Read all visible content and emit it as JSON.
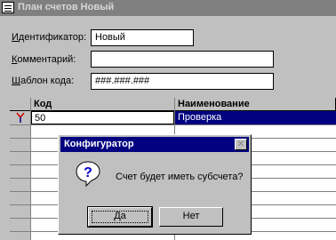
{
  "window": {
    "title": "План счетов Новый",
    "icon": "form-icon"
  },
  "form": {
    "id_label": "Идентификатор:",
    "id_value": "Новый",
    "comment_label": "Комментарий:",
    "comment_value": "",
    "template_label": "Шаблон кода:",
    "template_value": "###.###.###"
  },
  "grid": {
    "columns": [
      "Код",
      "Наименование"
    ],
    "rows": [
      {
        "code": "50",
        "name": "Проверка",
        "marker": "edit-marker-icon"
      }
    ],
    "selected_color": "#000080"
  },
  "dialog": {
    "title": "Конфигуратор",
    "close_glyph": "✕",
    "icon": "question-icon",
    "message": "Счет будет иметь субсчета?",
    "yes_label": "Да",
    "no_label": "Нет"
  }
}
